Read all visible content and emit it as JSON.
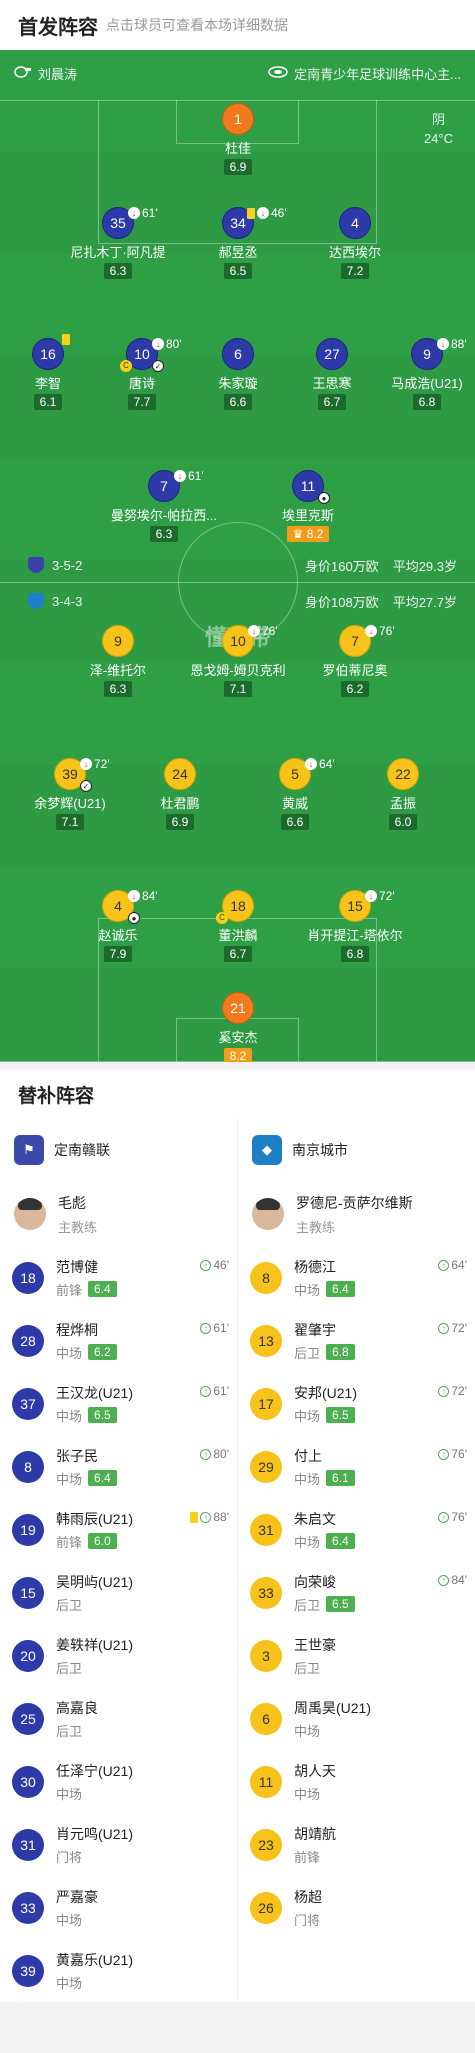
{
  "header": {
    "title": "首发阵容",
    "subtitle": "点击球员可查看本场详细数据"
  },
  "pitch": {
    "referee": "刘晨涛",
    "stadium": "定南青少年足球训练中心主...",
    "weather": "阴",
    "temperature": "24°C",
    "watermark": "懂球帝"
  },
  "home_formation": {
    "shape": "3-5-2",
    "value": "身价160万欧",
    "age": "平均29.3岁"
  },
  "away_formation": {
    "shape": "3-4-3",
    "value": "身价108万欧",
    "age": "平均27.7岁"
  },
  "home_players": [
    {
      "num": "1",
      "name": "杜佳",
      "rating": "6.9",
      "sub": "",
      "card": false
    },
    {
      "num": "35",
      "name": "尼扎木丁·阿凡提",
      "rating": "6.3",
      "sub": "61'",
      "card": false
    },
    {
      "num": "34",
      "name": "郝昱丞",
      "rating": "6.5",
      "sub": "46'",
      "card": true
    },
    {
      "num": "4",
      "name": "达西埃尔",
      "rating": "7.2",
      "sub": "",
      "card": false
    },
    {
      "num": "16",
      "name": "李智",
      "rating": "6.1",
      "sub": "",
      "card": true
    },
    {
      "num": "10",
      "name": "唐诗",
      "rating": "7.7",
      "sub": "80'",
      "card": false
    },
    {
      "num": "6",
      "name": "朱家璇",
      "rating": "6.6",
      "sub": "",
      "card": false
    },
    {
      "num": "27",
      "name": "王思寒",
      "rating": "6.7",
      "sub": "",
      "card": false
    },
    {
      "num": "9",
      "name": "马成浩(U21)",
      "rating": "6.8",
      "sub": "88'",
      "card": false
    },
    {
      "num": "7",
      "name": "曼努埃尔-帕拉西...",
      "rating": "6.3",
      "sub": "61'",
      "card": false
    },
    {
      "num": "11",
      "name": "埃里克斯",
      "rating": "8.2",
      "sub": "",
      "card": false
    }
  ],
  "away_players": [
    {
      "num": "9",
      "name": "泽-维托尔",
      "rating": "6.3",
      "sub": ""
    },
    {
      "num": "10",
      "name": "恩戈姆-姆贝克利",
      "rating": "7.1",
      "sub": "76'"
    },
    {
      "num": "7",
      "name": "罗伯蒂尼奥",
      "rating": "6.2",
      "sub": "76'"
    },
    {
      "num": "39",
      "name": "余梦辉(U21)",
      "rating": "7.1",
      "sub": "72'"
    },
    {
      "num": "24",
      "name": "杜君鹏",
      "rating": "6.9",
      "sub": ""
    },
    {
      "num": "5",
      "name": "黄威",
      "rating": "6.6",
      "sub": "64'"
    },
    {
      "num": "22",
      "name": "孟振",
      "rating": "6.0",
      "sub": ""
    },
    {
      "num": "4",
      "name": "赵诚乐",
      "rating": "7.9",
      "sub": "84'"
    },
    {
      "num": "18",
      "name": "董洪麟",
      "rating": "6.7",
      "sub": ""
    },
    {
      "num": "15",
      "name": "肖开提江-塔依尔",
      "rating": "6.8",
      "sub": "72'"
    },
    {
      "num": "21",
      "name": "奚安杰",
      "rating": "8.2",
      "sub": ""
    }
  ],
  "bench": {
    "title": "替补阵容",
    "home": {
      "team": "定南赣联",
      "coach": {
        "name": "毛彪",
        "role": "主教练"
      },
      "players": [
        {
          "num": "18",
          "name": "范博健",
          "pos": "前锋",
          "rating": "6.4",
          "sub": "46'"
        },
        {
          "num": "28",
          "name": "程烨桐",
          "pos": "中场",
          "rating": "6.2",
          "sub": "61'"
        },
        {
          "num": "37",
          "name": "王汉龙(U21)",
          "pos": "中场",
          "rating": "6.5",
          "sub": "61'"
        },
        {
          "num": "8",
          "name": "张子民",
          "pos": "中场",
          "rating": "6.4",
          "sub": "80'"
        },
        {
          "num": "19",
          "name": "韩雨辰(U21)",
          "pos": "前锋",
          "rating": "6.0",
          "sub": "88'"
        },
        {
          "num": "15",
          "name": "吴明屿(U21)",
          "pos": "后卫",
          "rating": "",
          "sub": ""
        },
        {
          "num": "20",
          "name": "姜轶祥(U21)",
          "pos": "后卫",
          "rating": "",
          "sub": ""
        },
        {
          "num": "25",
          "name": "高嘉良",
          "pos": "后卫",
          "rating": "",
          "sub": ""
        },
        {
          "num": "30",
          "name": "任泽宁(U21)",
          "pos": "中场",
          "rating": "",
          "sub": ""
        },
        {
          "num": "31",
          "name": "肖元鸣(U21)",
          "pos": "门将",
          "rating": "",
          "sub": ""
        },
        {
          "num": "33",
          "name": "严嘉豪",
          "pos": "中场",
          "rating": "",
          "sub": ""
        },
        {
          "num": "39",
          "name": "黄嘉乐(U21)",
          "pos": "中场",
          "rating": "",
          "sub": ""
        }
      ]
    },
    "away": {
      "team": "南京城市",
      "coach": {
        "name": "罗德尼-贡萨尔维斯",
        "role": "主教练"
      },
      "players": [
        {
          "num": "8",
          "name": "杨德江",
          "pos": "中场",
          "rating": "6.4",
          "sub": "64'"
        },
        {
          "num": "13",
          "name": "翟肇宇",
          "pos": "后卫",
          "rating": "6.8",
          "sub": "72'"
        },
        {
          "num": "17",
          "name": "安邦(U21)",
          "pos": "中场",
          "rating": "6.5",
          "sub": "72'"
        },
        {
          "num": "29",
          "name": "付上",
          "pos": "中场",
          "rating": "6.1",
          "sub": "76'"
        },
        {
          "num": "31",
          "name": "朱启文",
          "pos": "中场",
          "rating": "6.4",
          "sub": "76'"
        },
        {
          "num": "33",
          "name": "向荣峻",
          "pos": "后卫",
          "rating": "6.5",
          "sub": "84'"
        },
        {
          "num": "3",
          "name": "王世豪",
          "pos": "后卫",
          "rating": "",
          "sub": ""
        },
        {
          "num": "6",
          "name": "周禹昊(U21)",
          "pos": "中场",
          "rating": "",
          "sub": ""
        },
        {
          "num": "11",
          "name": "胡人天",
          "pos": "中场",
          "rating": "",
          "sub": ""
        },
        {
          "num": "23",
          "name": "胡靖航",
          "pos": "前锋",
          "rating": "",
          "sub": ""
        },
        {
          "num": "26",
          "name": "杨超",
          "pos": "门将",
          "rating": "",
          "sub": ""
        }
      ]
    }
  }
}
